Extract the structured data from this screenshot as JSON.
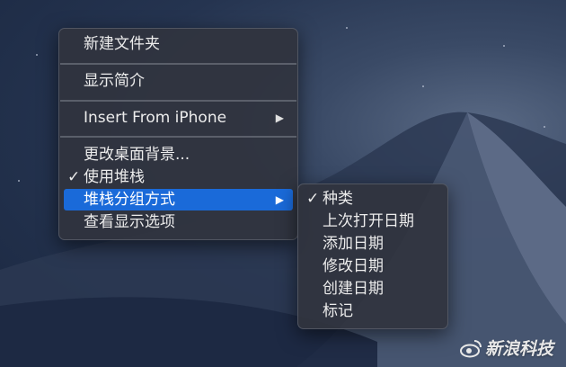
{
  "main_menu": {
    "items": [
      {
        "label": "新建文件夹"
      },
      {
        "label": "显示简介"
      },
      {
        "label": "Insert From iPhone",
        "arrow": "▶"
      },
      {
        "label": "更改桌面背景..."
      },
      {
        "label": "使用堆栈",
        "check": "✓"
      },
      {
        "label": "堆栈分组方式",
        "arrow": "▶"
      },
      {
        "label": "查看显示选项"
      }
    ]
  },
  "sub_menu": {
    "items": [
      {
        "label": "种类",
        "check": "✓"
      },
      {
        "label": "上次打开日期"
      },
      {
        "label": "添加日期"
      },
      {
        "label": "修改日期"
      },
      {
        "label": "创建日期"
      },
      {
        "label": "标记"
      }
    ]
  },
  "watermark": {
    "text": "新浪科技",
    "logo": "sina"
  },
  "colors": {
    "highlight": "#1a6ad9",
    "menu_bg": "#30343e",
    "text": "#ececec"
  }
}
